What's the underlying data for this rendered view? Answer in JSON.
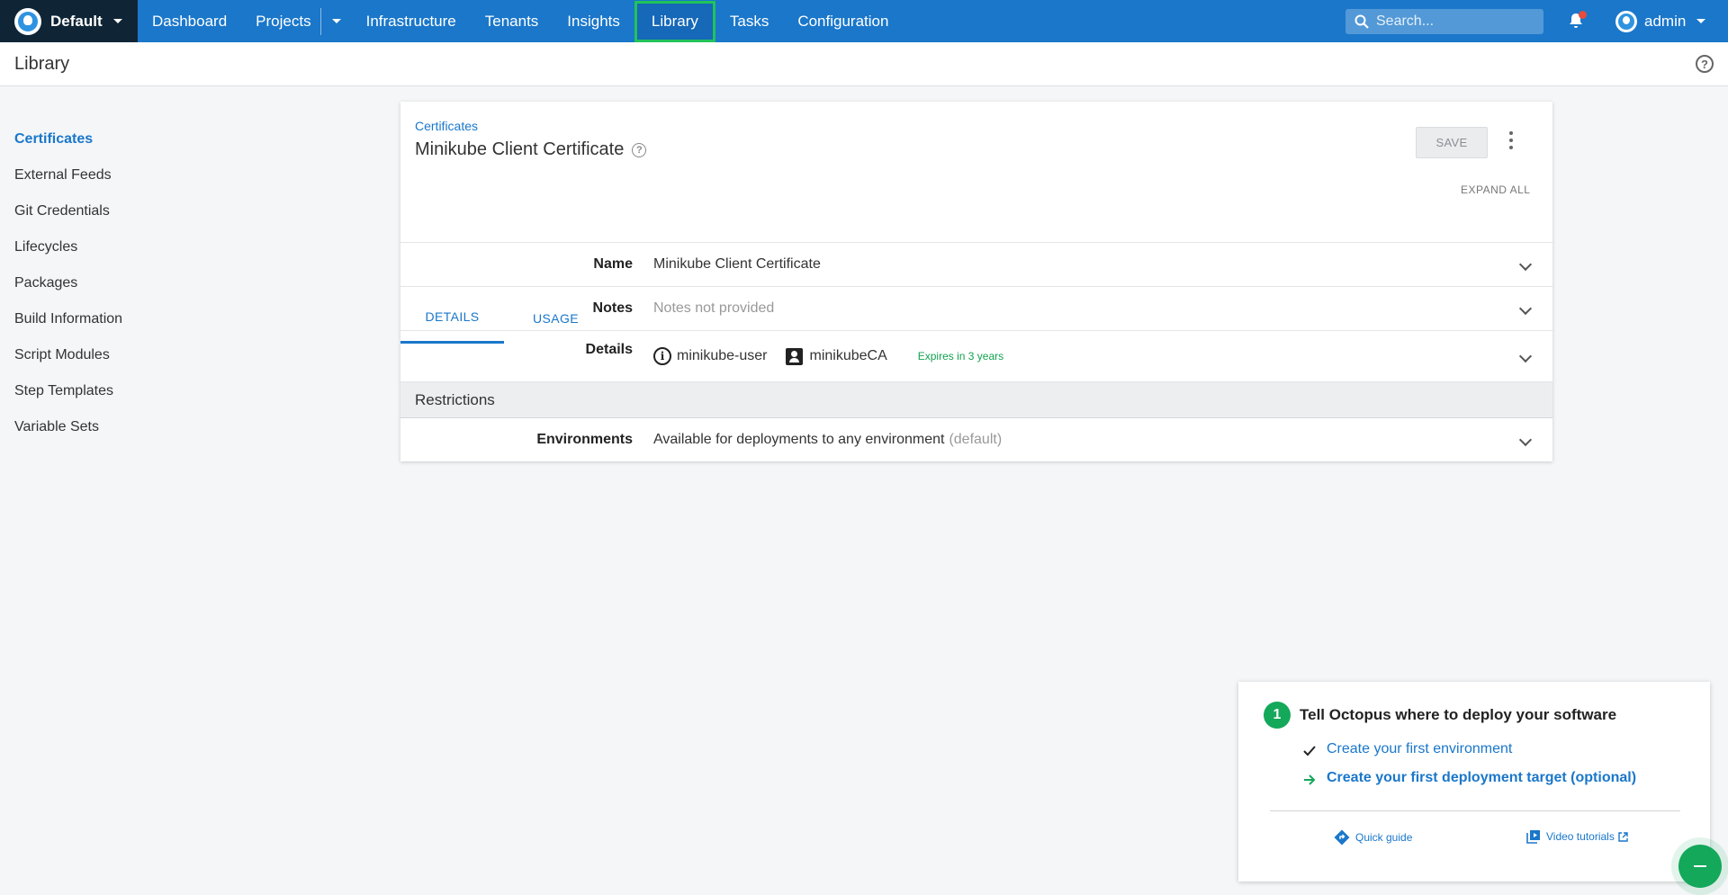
{
  "topbar": {
    "space_label": "Default",
    "nav_items": [
      "Dashboard",
      "Projects",
      "Infrastructure",
      "Tenants",
      "Insights",
      "Library",
      "Tasks",
      "Configuration"
    ],
    "active_nav": "Library",
    "search_placeholder": "Search...",
    "user_name": "admin",
    "notification_dot_color": "#e74c3c",
    "bar_color": "#1a77ca",
    "space_bg": "#0f2535",
    "active_outline": "#21c35a"
  },
  "page": {
    "title": "Library"
  },
  "sidebar": {
    "items": [
      "Certificates",
      "External Feeds",
      "Git Credentials",
      "Lifecycles",
      "Packages",
      "Build Information",
      "Script Modules",
      "Step Templates",
      "Variable Sets"
    ],
    "active": "Certificates"
  },
  "card": {
    "breadcrumb": "Certificates",
    "title": "Minikube Client Certificate",
    "save_label": "SAVE",
    "expand_all_label": "EXPAND ALL",
    "tabs": [
      "DETAILS",
      "USAGE"
    ],
    "active_tab": "DETAILS",
    "fields": {
      "name": {
        "label": "Name",
        "value": "Minikube Client Certificate"
      },
      "notes": {
        "label": "Notes",
        "value": "Notes not provided"
      },
      "details": {
        "label": "Details",
        "subject": "minikube-user",
        "issuer": "minikubeCA",
        "expiry": "Expires in 3 years"
      }
    },
    "restrictions_heading": "Restrictions",
    "environments": {
      "label": "Environments",
      "value": "Available for deployments to any environment",
      "suffix": "(default)"
    }
  },
  "getting_started": {
    "step_number": "1",
    "title": "Tell Octopus where to deploy your software",
    "links": [
      {
        "label": "Create your first environment",
        "state": "done"
      },
      {
        "label": "Create your first deployment target (optional)",
        "state": "next"
      }
    ],
    "quick_guide": "Quick guide",
    "video_tutorials": "Video tutorials"
  }
}
